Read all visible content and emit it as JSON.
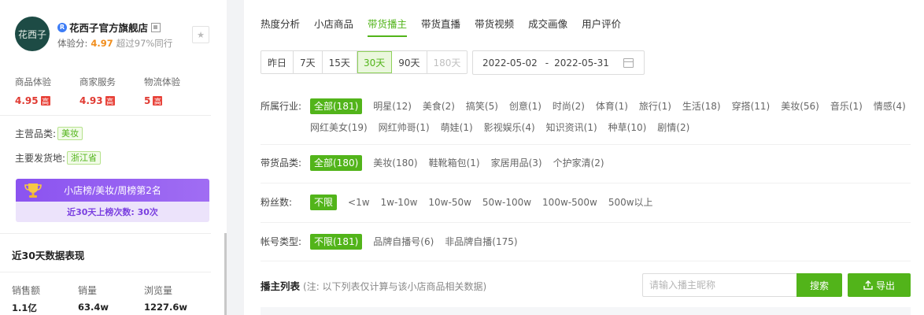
{
  "shop": {
    "logo_text": "花西子",
    "verified_badge": "R",
    "name": "花西子官方旗舰店",
    "score_label": "体验分:",
    "score_value": "4.97",
    "score_compare": "超过97%同行"
  },
  "metrics": [
    {
      "label": "商品体验",
      "value": "4.95",
      "level": "高"
    },
    {
      "label": "商家服务",
      "value": "4.93",
      "level": "高"
    },
    {
      "label": "物流体验",
      "value": "5",
      "level": "高"
    }
  ],
  "category": {
    "label": "主营品类:",
    "value": "美妆"
  },
  "ship_from": {
    "label": "主要发货地:",
    "value": "浙江省"
  },
  "rank": {
    "title": "小店榜/美妆/周榜第2名",
    "subtitle": "近30天上榜次数: 30次"
  },
  "recent": {
    "title": "近30天数据表现",
    "stats": [
      {
        "label": "销售额",
        "value": "1.1亿"
      },
      {
        "label": "销量",
        "value": "63.4w"
      },
      {
        "label": "浏览量",
        "value": "1227.6w"
      }
    ]
  },
  "tabs": [
    "热度分析",
    "小店商品",
    "带货播主",
    "带货直播",
    "带货视频",
    "成交画像",
    "用户评价"
  ],
  "active_tab": "带货播主",
  "periods": [
    "昨日",
    "7天",
    "15天",
    "30天",
    "90天",
    "180天"
  ],
  "active_period": "30天",
  "date_range": {
    "start": "2022-05-02",
    "sep": "-",
    "end": "2022-05-31"
  },
  "filters": {
    "industry": {
      "label": "所属行业:",
      "options": [
        "全部(181)",
        "明星(12)",
        "美食(2)",
        "搞笑(5)",
        "创意(1)",
        "时尚(2)",
        "体育(1)",
        "旅行(1)",
        "生活(18)",
        "穿搭(11)",
        "美妆(56)",
        "音乐(1)",
        "情感(4)",
        "网红美女(19)",
        "网红帅哥(1)",
        "萌娃(1)",
        "影视娱乐(4)",
        "知识资讯(1)",
        "种草(10)",
        "剧情(2)"
      ]
    },
    "goods": {
      "label": "带货品类:",
      "options": [
        "全部(180)",
        "美妆(180)",
        "鞋靴箱包(1)",
        "家居用品(3)",
        "个护家清(2)"
      ]
    },
    "fans": {
      "label": "粉丝数:",
      "options": [
        "不限",
        "<1w",
        "1w-10w",
        "10w-50w",
        "50w-100w",
        "100w-500w",
        "500w以上"
      ]
    },
    "account": {
      "label": "帐号类型:",
      "options": [
        "不限(181)",
        "品牌自播号(6)",
        "非品牌自播(175)"
      ]
    }
  },
  "list": {
    "title": "播主列表",
    "note": "(注: 以下列表仅计算与该小店商品相关数据)",
    "search_placeholder": "请输入播主昵称",
    "search_button": "搜索",
    "export_button": "导出"
  },
  "colors": {
    "accent": "#52b41a",
    "alert": "#e03a32",
    "score": "#f08d1c",
    "rank_purple": "#8b53f0"
  }
}
